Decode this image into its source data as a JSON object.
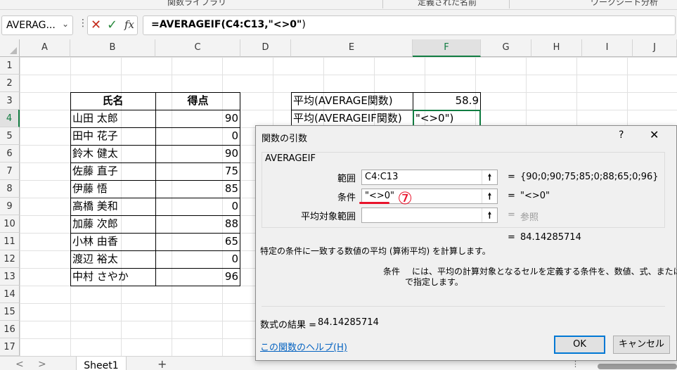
{
  "ribbon": {
    "labels": [
      "関数ライブラリ",
      "定義された名前",
      "ワークシート分析"
    ]
  },
  "formula_bar": {
    "name_box": "AVERAG...",
    "formula_prefix": "=AVERAGEIF(",
    "formula_args": "C4:C13,\"<>0\"",
    "formula_suffix": ")",
    "cancel_icon": "x-icon",
    "enter_icon": "check-icon",
    "fx_label": "fx"
  },
  "grid": {
    "columns": [
      "A",
      "B",
      "C",
      "D",
      "E",
      "F",
      "G",
      "H",
      "I",
      "J"
    ],
    "selected_column": "F",
    "rows": [
      "1",
      "2",
      "3",
      "4",
      "5",
      "6",
      "7",
      "8",
      "9",
      "10",
      "11",
      "12",
      "13",
      "14",
      "15",
      "16",
      "17"
    ],
    "selected_row": "4",
    "table_headers": {
      "name": "氏名",
      "score": "得点"
    },
    "table_rows": [
      {
        "name": "山田 太郎",
        "score": "90"
      },
      {
        "name": "田中 花子",
        "score": "0"
      },
      {
        "name": "鈴木 健太",
        "score": "90"
      },
      {
        "name": "佐藤 直子",
        "score": "75"
      },
      {
        "name": "伊藤 悟",
        "score": "85"
      },
      {
        "name": "高橋 美和",
        "score": "0"
      },
      {
        "name": "加藤 次郎",
        "score": "88"
      },
      {
        "name": "小林 由香",
        "score": "65"
      },
      {
        "name": "渡辺 裕太",
        "score": "0"
      },
      {
        "name": "中村 さやか",
        "score": "96"
      }
    ],
    "summary": [
      {
        "label": "平均(AVERAGE関数)",
        "value": "58.9"
      },
      {
        "label": "平均(AVERAGEIF関数)",
        "value": "\"<>0\")"
      }
    ]
  },
  "sheet_tabs": {
    "active": "Sheet1",
    "add": "+",
    "prev": "<",
    "next": ">",
    "more": "⋮"
  },
  "dialog": {
    "title": "関数の引数",
    "help": "?",
    "close": "✕",
    "function_name": "AVERAGEIF",
    "args": [
      {
        "label": "範囲",
        "value": "C4:C13",
        "result": "{90;0;90;75;85;0;88;65;0;96}",
        "result_gray": false
      },
      {
        "label": "条件",
        "value": "\"<>0\"",
        "result": "\"<>0\"",
        "result_gray": false
      },
      {
        "label": "平均対象範囲",
        "value": "",
        "result": "参照",
        "result_gray": true
      }
    ],
    "eq": "=",
    "function_result": "84.14285714",
    "description": "特定の条件に一致する数値の平均 (算術平均) を計算します。",
    "arg_help_name": "条件",
    "arg_help_line1": "には、平均の計算対象となるセルを定義する条件を、数値、式、または文字列",
    "arg_help_line2": "で指定します。",
    "formula_result_label": "数式の結果 =",
    "formula_result_value": "84.14285714",
    "help_link": "この関数のヘルプ(H)",
    "ok": "OK",
    "cancel": "キャンセル"
  },
  "annotation": {
    "marker": "⑦",
    "color": "#e8132b"
  },
  "colors": {
    "excel_green": "#107c41",
    "link_blue": "#0563c1",
    "accent": "#0078d4"
  }
}
